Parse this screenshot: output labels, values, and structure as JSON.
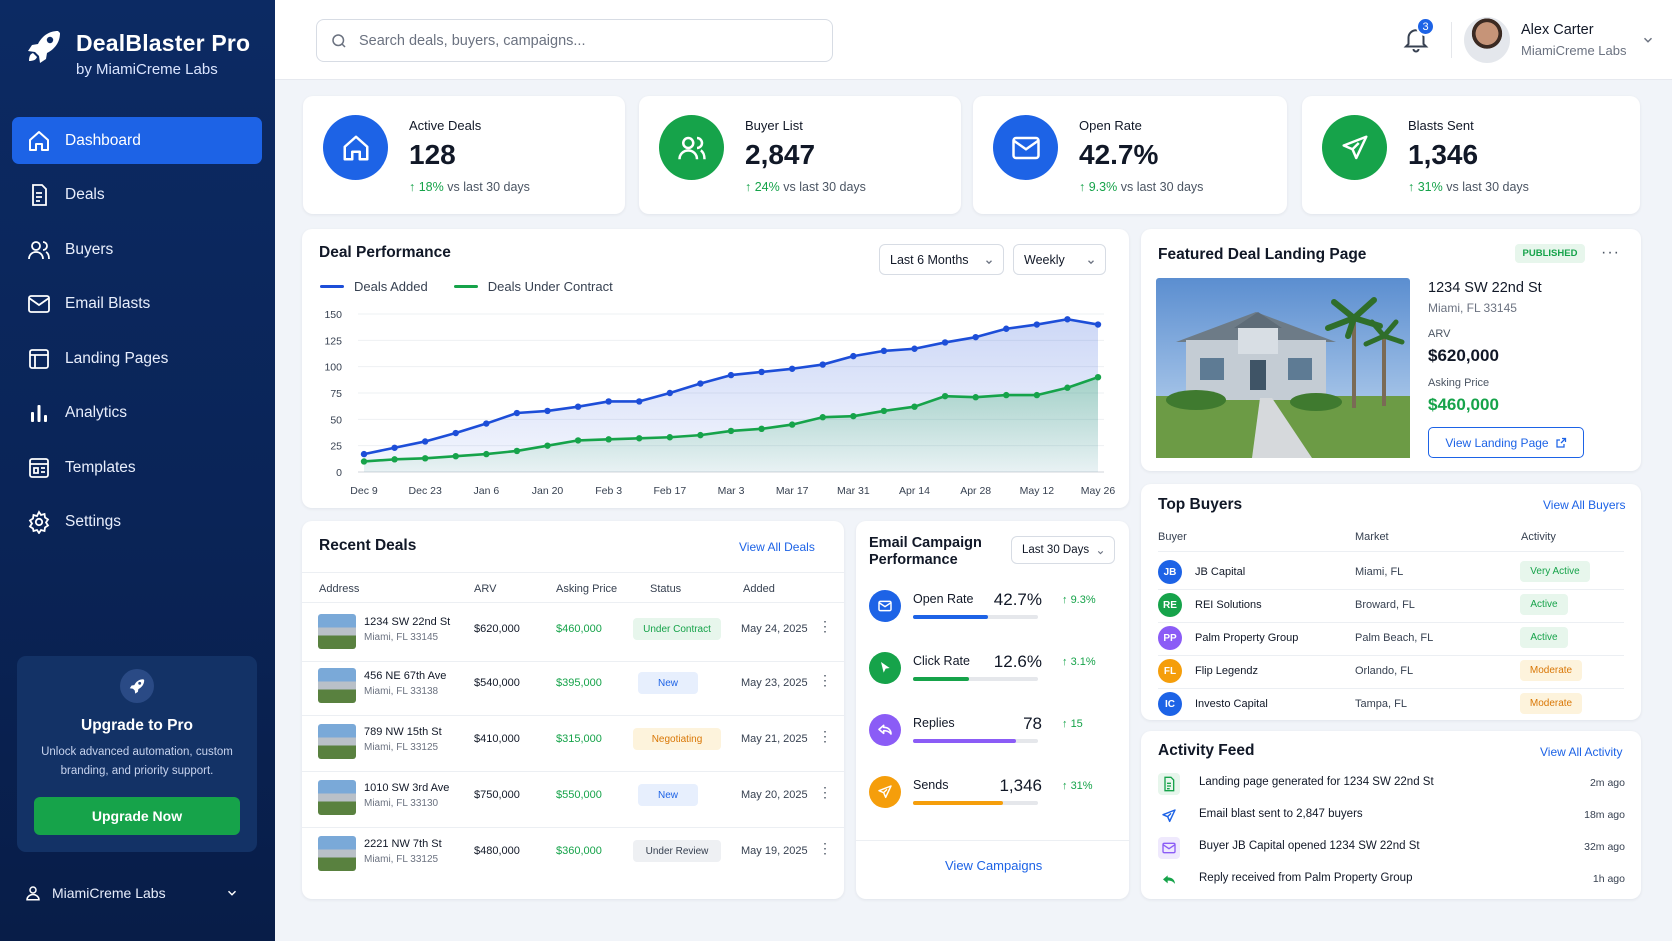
{
  "brand": {
    "title": "DealBlaster Pro",
    "subtitle": "by MiamiCreme Labs"
  },
  "nav": [
    {
      "label": "Dashboard",
      "icon": "home-icon"
    },
    {
      "label": "Deals",
      "icon": "document-icon"
    },
    {
      "label": "Buyers",
      "icon": "users-icon"
    },
    {
      "label": "Email Blasts",
      "icon": "mail-icon"
    },
    {
      "label": "Landing Pages",
      "icon": "layout-icon"
    },
    {
      "label": "Analytics",
      "icon": "bar-chart-icon"
    },
    {
      "label": "Templates",
      "icon": "template-icon"
    },
    {
      "label": "Settings",
      "icon": "gear-icon"
    }
  ],
  "upgrade": {
    "title": "Upgrade to Pro",
    "text": "Unlock advanced automation, custom branding, and priority support.",
    "button": "Upgrade Now"
  },
  "org": {
    "name": "MiamiCreme Labs"
  },
  "search": {
    "placeholder": "Search deals, buyers, campaigns..."
  },
  "notifications": {
    "count": "3"
  },
  "user": {
    "name": "Alex Carter",
    "org": "MiamiCreme Labs"
  },
  "stats": [
    {
      "label": "Active Deals",
      "value": "128",
      "change": "18%",
      "suffix": "vs last 30 days",
      "color": "#1d63e6"
    },
    {
      "label": "Buyer List",
      "value": "2,847",
      "change": "24%",
      "suffix": "vs last 30 days",
      "color": "#16a34a"
    },
    {
      "label": "Open Rate",
      "value": "42.7%",
      "change": "9.3%",
      "suffix": "vs last 30 days",
      "color": "#1d63e6"
    },
    {
      "label": "Blasts Sent",
      "value": "1,346",
      "change": "31%",
      "suffix": "vs last 30 days",
      "color": "#16a34a"
    }
  ],
  "performance": {
    "title": "Deal Performance",
    "range": "Last 6 Months",
    "interval": "Weekly"
  },
  "chart_data": {
    "type": "area",
    "title": "Deal Performance",
    "x": [
      "Dec 9",
      "Dec 16",
      "Dec 23",
      "Dec 30",
      "Jan 6",
      "Jan 13",
      "Jan 20",
      "Jan 27",
      "Feb 3",
      "Feb 10",
      "Feb 17",
      "Feb 24",
      "Mar 3",
      "Mar 10",
      "Mar 17",
      "Mar 24",
      "Mar 31",
      "Apr 7",
      "Apr 14",
      "Apr 21",
      "Apr 28",
      "May 5",
      "May 12",
      "May 19",
      "May 26"
    ],
    "tick_labels": [
      "Dec 9",
      "Dec 23",
      "Jan 6",
      "Jan 20",
      "Feb 3",
      "Feb 17",
      "Mar 3",
      "Mar 17",
      "Mar 31",
      "Apr 14",
      "Apr 28",
      "May 12",
      "May 26"
    ],
    "yticks": [
      0,
      25,
      50,
      75,
      100,
      125,
      150
    ],
    "ylim": [
      0,
      150
    ],
    "grid": true,
    "legend": "top-left",
    "series": [
      {
        "name": "Deals Added",
        "color": "#1d4ed8",
        "values": [
          17,
          23,
          29,
          37,
          46,
          56,
          58,
          62,
          67,
          67,
          75,
          84,
          92,
          95,
          98,
          102,
          110,
          115,
          117,
          123,
          128,
          136,
          140,
          145,
          140
        ]
      },
      {
        "name": "Deals Under Contract",
        "color": "#16a34a",
        "values": [
          10,
          12,
          13,
          15,
          17,
          20,
          25,
          30,
          31,
          32,
          33,
          35,
          39,
          41,
          45,
          52,
          53,
          58,
          62,
          72,
          71,
          73,
          73,
          80,
          90
        ]
      }
    ]
  },
  "featured": {
    "title": "Featured Deal Landing Page",
    "badge": "PUBLISHED",
    "address": "1234 SW 22nd St",
    "city": "Miami, FL 33145",
    "arv_label": "ARV",
    "arv": "$620,000",
    "asking_label": "Asking Price",
    "asking": "$460,000",
    "button": "View Landing Page"
  },
  "recent": {
    "title": "Recent Deals",
    "link": "View All Deals",
    "headers": [
      "Address",
      "ARV",
      "Asking Price",
      "Status",
      "Added"
    ],
    "rows": [
      {
        "address": "1234 SW 22nd St",
        "city": "Miami, FL 33145",
        "arv": "$620,000",
        "asking": "$460,000",
        "status": "Under Contract",
        "added": "May 24, 2025",
        "status_color": "#16a34a",
        "status_bg": "#e7f6ec"
      },
      {
        "address": "456 NE 67th Ave",
        "city": "Miami, FL 33138",
        "arv": "$540,000",
        "asking": "$395,000",
        "status": "New",
        "added": "May 23, 2025",
        "status_color": "#1d63e6",
        "status_bg": "#e7effd"
      },
      {
        "address": "789 NW 15th St",
        "city": "Miami, FL 33125",
        "arv": "$410,000",
        "asking": "$315,000",
        "status": "Negotiating",
        "added": "May 21, 2025",
        "status_color": "#d97706",
        "status_bg": "#fdf3dc"
      },
      {
        "address": "1010 SW 3rd Ave",
        "city": "Miami, FL 33130",
        "arv": "$750,000",
        "asking": "$550,000",
        "status": "New",
        "added": "May 20, 2025",
        "status_color": "#1d63e6",
        "status_bg": "#e7effd"
      },
      {
        "address": "2221 NW 7th St",
        "city": "Miami, FL 33125",
        "arv": "$480,000",
        "asking": "$360,000",
        "status": "Under Review",
        "added": "May 19, 2025",
        "status_color": "#374151",
        "status_bg": "#eef0f3"
      }
    ]
  },
  "campaign": {
    "title_line1": "Email Campaign",
    "title_line2": "Performance",
    "range": "Last 30 Days",
    "link": "View Campaigns",
    "metrics": [
      {
        "label": "Open Rate",
        "value": "42.7%",
        "change": "9.3%",
        "progress": 0.6,
        "color": "#1d63e6"
      },
      {
        "label": "Click Rate",
        "value": "12.6%",
        "change": "3.1%",
        "progress": 0.45,
        "color": "#16a34a"
      },
      {
        "label": "Replies",
        "value": "78",
        "change": "15",
        "progress": 0.82,
        "color": "#8b5cf6"
      },
      {
        "label": "Sends",
        "value": "1,346",
        "change": "31%",
        "progress": 0.72,
        "color": "#f59e0b"
      }
    ]
  },
  "buyers": {
    "title": "Top Buyers",
    "link": "View All Buyers",
    "headers": [
      "Buyer",
      "Market",
      "Activity"
    ],
    "rows": [
      {
        "initials": "JB",
        "name": "JB Capital",
        "market": "Miami, FL",
        "activity": "Very Active",
        "color": "#1d63e6",
        "act_color": "#16a34a",
        "act_bg": "#e7f6ec"
      },
      {
        "initials": "RE",
        "name": "REI Solutions",
        "market": "Broward, FL",
        "activity": "Active",
        "color": "#16a34a",
        "act_color": "#16a34a",
        "act_bg": "#e7f6ec"
      },
      {
        "initials": "PP",
        "name": "Palm Property Group",
        "market": "Palm Beach, FL",
        "activity": "Active",
        "color": "#8b5cf6",
        "act_color": "#16a34a",
        "act_bg": "#e7f6ec"
      },
      {
        "initials": "FL",
        "name": "Flip Legendz",
        "market": "Orlando, FL",
        "activity": "Moderate",
        "color": "#f59e0b",
        "act_color": "#d97706",
        "act_bg": "#fdf3dc"
      },
      {
        "initials": "IC",
        "name": "Investo Capital",
        "market": "Tampa, FL",
        "activity": "Moderate",
        "color": "#1d63e6",
        "act_color": "#d97706",
        "act_bg": "#fdf3dc"
      }
    ]
  },
  "feed": {
    "title": "Activity Feed",
    "link": "View All Activity",
    "items": [
      {
        "text": "Landing page generated for 1234 SW 22nd St",
        "time": "2m ago",
        "icon": "document-icon",
        "color": "#16a34a"
      },
      {
        "text": "Email blast sent to 2,847 buyers",
        "time": "18m ago",
        "icon": "send-icon",
        "color": "#1d63e6"
      },
      {
        "text": "Buyer JB Capital opened 1234 SW 22nd St",
        "time": "32m ago",
        "icon": "mail-icon",
        "color": "#8b5cf6"
      },
      {
        "text": "Reply received from Palm Property Group",
        "time": "1h ago",
        "icon": "reply-icon",
        "color": "#16a34a"
      }
    ]
  }
}
